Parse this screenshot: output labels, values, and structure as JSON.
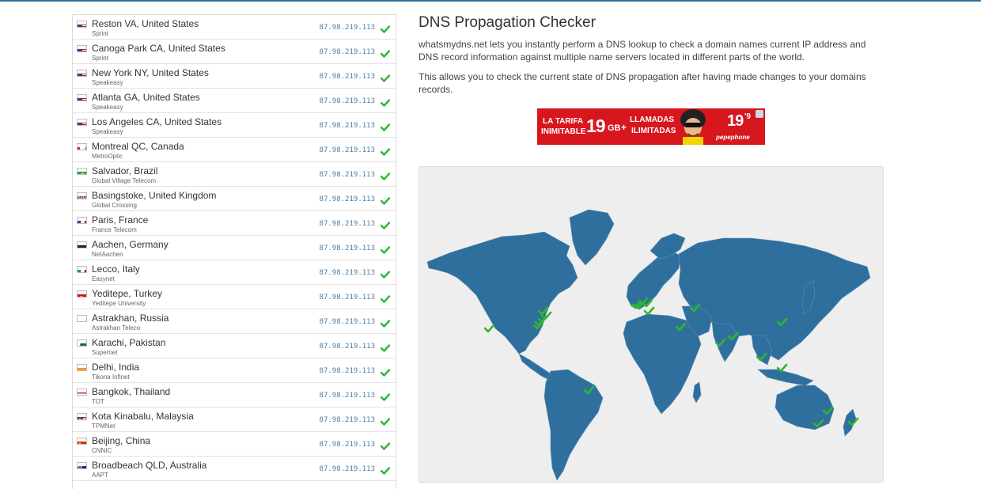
{
  "page": {
    "title": "DNS Propagation Checker",
    "intro": "whatsmydns.net lets you instantly perform a DNS lookup to check a domain names current IP address and DNS record information against multiple name servers located in different parts of the world.",
    "intro2": "This allows you to check the current state of DNS propagation after having made changes to your domains records."
  },
  "ad": {
    "text1": "LA TARIFA",
    "text2": "INIMITABLE",
    "gb": "19",
    "gb_unit": "GB",
    "plus": "+",
    "text3": "LLAMADAS",
    "text4": "ILIMITADAS",
    "price": "19",
    "price_dec": "'9",
    "brand": "pepephone"
  },
  "colors": {
    "accent": "#2f6f96",
    "land": "#2f6f9e",
    "check": "#2db82d",
    "ad_red": "#d7161e"
  },
  "servers": [
    {
      "location": "Reston VA, United States",
      "provider": "Sprint",
      "ip": "87.98.219.113",
      "flag": "us"
    },
    {
      "location": "Canoga Park CA, United States",
      "provider": "Sprint",
      "ip": "87.98.219.113",
      "flag": "us"
    },
    {
      "location": "New York NY, United States",
      "provider": "Speakeasy",
      "ip": "87.98.219.113",
      "flag": "us"
    },
    {
      "location": "Atlanta GA, United States",
      "provider": "Speakeasy",
      "ip": "87.98.219.113",
      "flag": "us"
    },
    {
      "location": "Los Angeles CA, United States",
      "provider": "Speakeasy",
      "ip": "87.98.219.113",
      "flag": "us"
    },
    {
      "location": "Montreal QC, Canada",
      "provider": "MetroOptic",
      "ip": "87.98.219.113",
      "flag": "ca"
    },
    {
      "location": "Salvador, Brazil",
      "provider": "Global Village Telecom",
      "ip": "87.98.219.113",
      "flag": "br"
    },
    {
      "location": "Basingstoke, United Kingdom",
      "provider": "Global Crossing",
      "ip": "87.98.219.113",
      "flag": "gb"
    },
    {
      "location": "Paris, France",
      "provider": "France Telecom",
      "ip": "87.98.219.113",
      "flag": "fr"
    },
    {
      "location": "Aachen, Germany",
      "provider": "NetAachen",
      "ip": "87.98.219.113",
      "flag": "de"
    },
    {
      "location": "Lecco, Italy",
      "provider": "Easynet",
      "ip": "87.98.219.113",
      "flag": "it"
    },
    {
      "location": "Yeditepe, Turkey",
      "provider": "Yeditepe University",
      "ip": "87.98.219.113",
      "flag": "tr"
    },
    {
      "location": "Astrakhan, Russia",
      "provider": "Astrakhan Teleco",
      "ip": "87.98.219.113",
      "flag": "ru"
    },
    {
      "location": "Karachi, Pakistan",
      "provider": "Supernet",
      "ip": "87.98.219.113",
      "flag": "pk"
    },
    {
      "location": "Delhi, India",
      "provider": "Tikona Infinet",
      "ip": "87.98.219.113",
      "flag": "in"
    },
    {
      "location": "Bangkok, Thailand",
      "provider": "TOT",
      "ip": "87.98.219.113",
      "flag": "th"
    },
    {
      "location": "Kota Kinabalu, Malaysia",
      "provider": "TPMNet",
      "ip": "87.98.219.113",
      "flag": "my"
    },
    {
      "location": "Beijing, China",
      "provider": "CNNIC",
      "ip": "87.98.219.113",
      "flag": "cn"
    },
    {
      "location": "Broadbeach QLD, Australia",
      "provider": "AAPT",
      "ip": "87.98.219.113",
      "flag": "au"
    }
  ]
}
